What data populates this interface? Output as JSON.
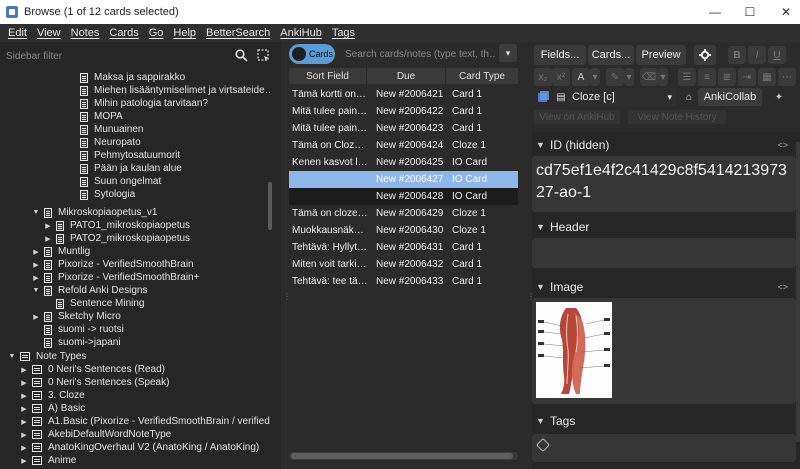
{
  "window": {
    "title": "Browse (1 of 12 cards selected)",
    "minimize": "—",
    "maximize": "☐",
    "close": "✕"
  },
  "menu": [
    "Edit",
    "View",
    "Notes",
    "Cards",
    "Go",
    "Help",
    "BetterSearch",
    "AnkiHub",
    "Tags"
  ],
  "sidebar": {
    "filter_placeholder": "Sidebar filter",
    "search_icon": "search-icon",
    "select_icon": "select-icon",
    "items": [
      {
        "label": "Maksa ja sappirakko",
        "kind": "deck"
      },
      {
        "label": "Miehen lisääntymiselimet ja virtsateide…",
        "kind": "deck"
      },
      {
        "label": "Mihin patologia tarvitaan?",
        "kind": "deck"
      },
      {
        "label": "MOPA",
        "kind": "deck"
      },
      {
        "label": "Munuainen",
        "kind": "deck"
      },
      {
        "label": "Neuropato",
        "kind": "deck"
      },
      {
        "label": "Pehmytosatuumorit",
        "kind": "deck"
      },
      {
        "label": "Pään ja kaulan alue",
        "kind": "deck"
      },
      {
        "label": "Suun ongelmat",
        "kind": "deck"
      },
      {
        "label": "Sytologia",
        "kind": "deck"
      },
      {
        "label": "Mikroskopiaopetus_v1",
        "kind": "deck"
      },
      {
        "label": "PATO1_mikroskopiaopetus",
        "kind": "deck"
      },
      {
        "label": "PATO2_mikroskopiaopetus",
        "kind": "deck"
      },
      {
        "label": "Muntlig",
        "kind": "deck"
      },
      {
        "label": "Pixorize - VerifiedSmoothBrain",
        "kind": "deck"
      },
      {
        "label": "Pixorize - VerifiedSmoothBrain+",
        "kind": "deck"
      },
      {
        "label": "Refold Anki Designs",
        "kind": "deck"
      },
      {
        "label": "Sentence Mining",
        "kind": "deck"
      },
      {
        "label": "Sketchy Micro",
        "kind": "deck"
      },
      {
        "label": "suomi -> ruotsi",
        "kind": "deck"
      },
      {
        "label": "suomi->japani",
        "kind": "deck"
      },
      {
        "label": "Note Types",
        "kind": "section"
      },
      {
        "label": "0 Neri's Sentences (Read)",
        "kind": "notetype"
      },
      {
        "label": "0 Neri's Sentences (Speak)",
        "kind": "notetype"
      },
      {
        "label": "3. Cloze",
        "kind": "notetype"
      },
      {
        "label": "A) Basic",
        "kind": "notetype"
      },
      {
        "label": "A1.Basic (Pixorize - VerifiedSmoothBrain / verified…",
        "kind": "notetype"
      },
      {
        "label": "AkebiDefaultWordNoteType",
        "kind": "notetype"
      },
      {
        "label": "AnatoKingOverhaul V2 (AnatoKing / AnatoKing)",
        "kind": "notetype"
      },
      {
        "label": "Anime",
        "kind": "notetype"
      }
    ]
  },
  "toolbar": {
    "toggle_label": "Cards",
    "search_placeholder": "Search cards/notes (type text, th…",
    "dropdown_glyph": "▾"
  },
  "table": {
    "columns": [
      "Sort Field",
      "Due",
      "Card Type"
    ],
    "rows": [
      {
        "sort": "Tämä kortti on…",
        "due": "New #2006421",
        "type": "Card 1"
      },
      {
        "sort": "Mitä tulee pain…",
        "due": "New #2006422",
        "type": "Card 1"
      },
      {
        "sort": "Mitä tulee pain…",
        "due": "New #2006423",
        "type": "Card 1"
      },
      {
        "sort": "Tämä on Cloz…",
        "due": "New #2006424",
        "type": "Cloze 1"
      },
      {
        "sort": "Kenen kasvot l…",
        "due": "New #2006425",
        "type": "IO Card"
      },
      {
        "sort": "",
        "due": "New #2006427",
        "type": "IO Card"
      },
      {
        "sort": "",
        "due": "New #2006428",
        "type": "IO Card"
      },
      {
        "sort": "Tämä on cloze…",
        "due": "New #2006429",
        "type": "Cloze 1"
      },
      {
        "sort": "Muokkausnäk…",
        "due": "New #2006430",
        "type": "Cloze 1"
      },
      {
        "sort": "Tehtävä: Hyllyt…",
        "due": "New #2006431",
        "type": "Card 1"
      },
      {
        "sort": "Miten voit tarki…",
        "due": "New #2006432",
        "type": "Card 1"
      },
      {
        "sort": "Tehtävä: tee tä…",
        "due": "New #2006433",
        "type": "Card 1"
      }
    ],
    "selected_index": 5
  },
  "editor": {
    "buttons": {
      "fields": "Fields...",
      "cards": "Cards...",
      "preview": "Preview"
    },
    "format": {
      "bold": "B",
      "italic": "I",
      "underline": "U"
    },
    "note_type": "Cloze [c]",
    "ankicollab": "AnkiCollab",
    "view_on_ankihub": "View on AnkiHub",
    "view_note_history": "View Note History",
    "fields": [
      {
        "name": "ID (hidden)",
        "value": "cd75ef1e4f2c41429c8f541421397327-ao-1"
      },
      {
        "name": "Header",
        "value": ""
      },
      {
        "name": "Image",
        "value": ""
      },
      {
        "name": "Tags",
        "value": ""
      }
    ],
    "code_glyph": "<>"
  },
  "colors": {
    "selection": "#8db6ea",
    "toggle": "#5a9bd8",
    "background": "#2b2b2b"
  }
}
